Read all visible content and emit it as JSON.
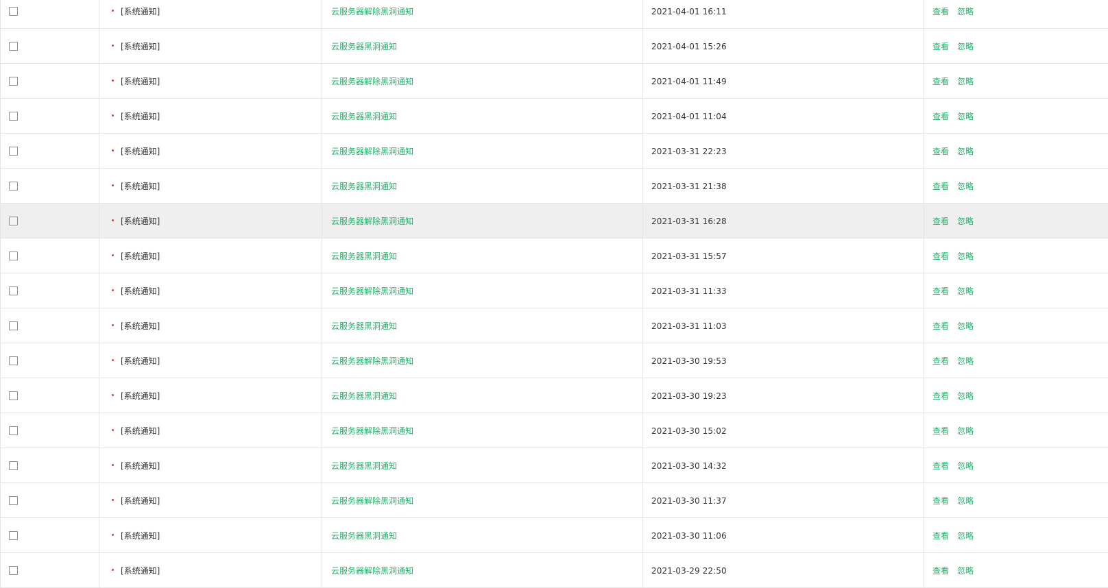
{
  "colors": {
    "accent_green": "#20b26a",
    "unread_dot": "#e4393c",
    "border": "#e5e5e5",
    "row_highlight": "#efefef"
  },
  "highlighted_row_index": 6,
  "rows": [
    {
      "type": "[系统通知]",
      "title": "云服务器解除黑洞通知",
      "time": "2021-04-01 16:11",
      "view": "查看",
      "ignore": "忽略"
    },
    {
      "type": "[系统通知]",
      "title": "云服务器黑洞通知",
      "time": "2021-04-01 15:26",
      "view": "查看",
      "ignore": "忽略"
    },
    {
      "type": "[系统通知]",
      "title": "云服务器解除黑洞通知",
      "time": "2021-04-01 11:49",
      "view": "查看",
      "ignore": "忽略"
    },
    {
      "type": "[系统通知]",
      "title": "云服务器黑洞通知",
      "time": "2021-04-01 11:04",
      "view": "查看",
      "ignore": "忽略"
    },
    {
      "type": "[系统通知]",
      "title": "云服务器解除黑洞通知",
      "time": "2021-03-31 22:23",
      "view": "查看",
      "ignore": "忽略"
    },
    {
      "type": "[系统通知]",
      "title": "云服务器黑洞通知",
      "time": "2021-03-31 21:38",
      "view": "查看",
      "ignore": "忽略"
    },
    {
      "type": "[系统通知]",
      "title": "云服务器解除黑洞通知",
      "time": "2021-03-31 16:28",
      "view": "查看",
      "ignore": "忽略"
    },
    {
      "type": "[系统通知]",
      "title": "云服务器黑洞通知",
      "time": "2021-03-31 15:57",
      "view": "查看",
      "ignore": "忽略"
    },
    {
      "type": "[系统通知]",
      "title": "云服务器解除黑洞通知",
      "time": "2021-03-31 11:33",
      "view": "查看",
      "ignore": "忽略"
    },
    {
      "type": "[系统通知]",
      "title": "云服务器黑洞通知",
      "time": "2021-03-31 11:03",
      "view": "查看",
      "ignore": "忽略"
    },
    {
      "type": "[系统通知]",
      "title": "云服务器解除黑洞通知",
      "time": "2021-03-30 19:53",
      "view": "查看",
      "ignore": "忽略"
    },
    {
      "type": "[系统通知]",
      "title": "云服务器黑洞通知",
      "time": "2021-03-30 19:23",
      "view": "查看",
      "ignore": "忽略"
    },
    {
      "type": "[系统通知]",
      "title": "云服务器解除黑洞通知",
      "time": "2021-03-30 15:02",
      "view": "查看",
      "ignore": "忽略"
    },
    {
      "type": "[系统通知]",
      "title": "云服务器黑洞通知",
      "time": "2021-03-30 14:32",
      "view": "查看",
      "ignore": "忽略"
    },
    {
      "type": "[系统通知]",
      "title": "云服务器解除黑洞通知",
      "time": "2021-03-30 11:37",
      "view": "查看",
      "ignore": "忽略"
    },
    {
      "type": "[系统通知]",
      "title": "云服务器黑洞通知",
      "time": "2021-03-30 11:06",
      "view": "查看",
      "ignore": "忽略"
    },
    {
      "type": "[系统通知]",
      "title": "云服务器解除黑洞通知",
      "time": "2021-03-29 22:50",
      "view": "查看",
      "ignore": "忽略"
    }
  ]
}
